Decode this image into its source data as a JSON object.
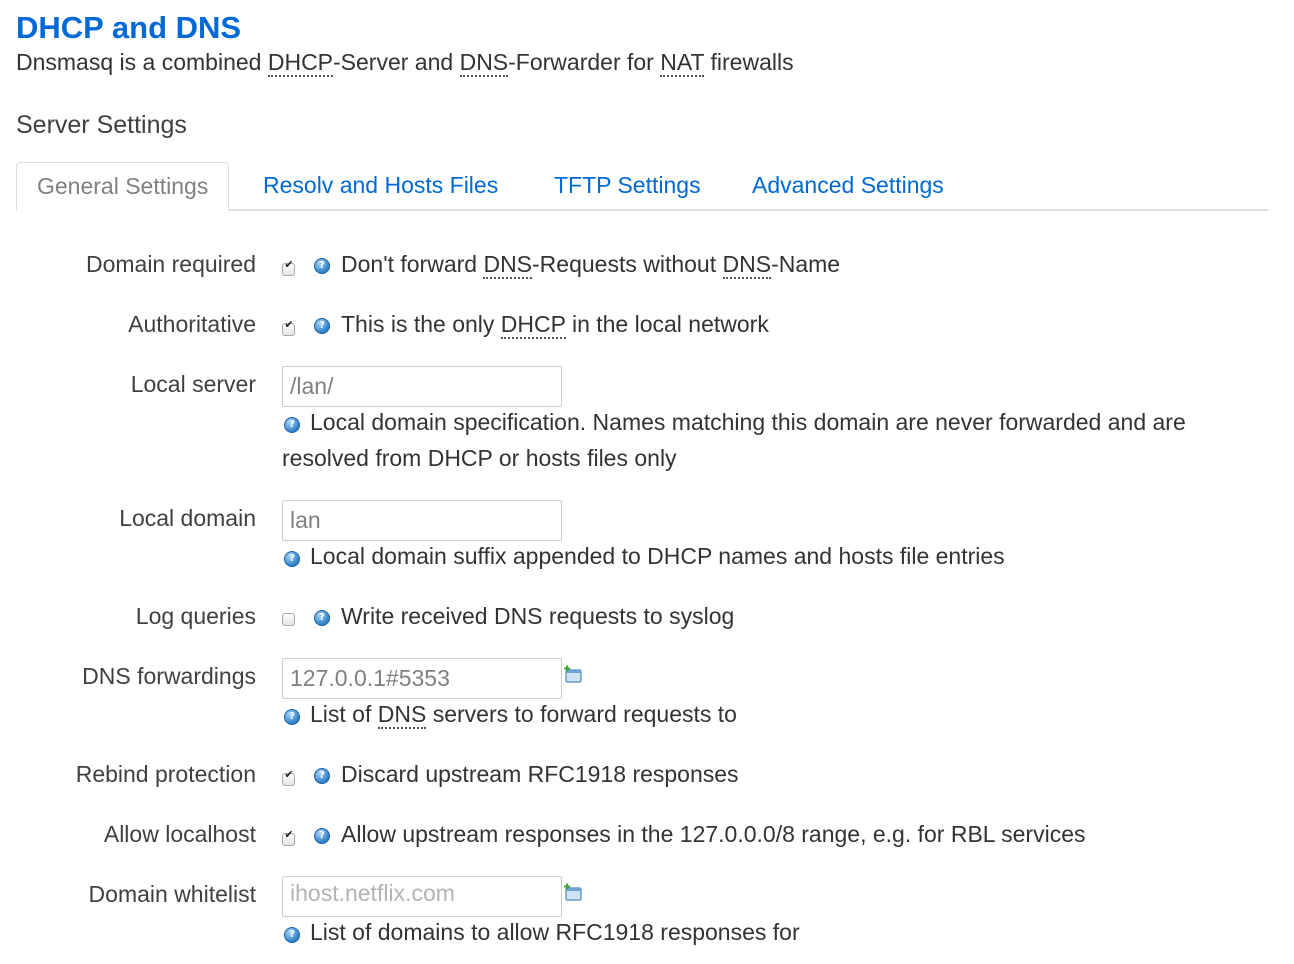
{
  "header": {
    "title": "DHCP and DNS",
    "desc_parts": [
      "Dnsmasq is a combined ",
      "DHCP",
      "-Server and ",
      "DNS",
      "-Forwarder for ",
      "NAT",
      " firewalls"
    ]
  },
  "section": {
    "title": "Server Settings"
  },
  "tabs": [
    {
      "label": "General Settings",
      "active": true
    },
    {
      "label": "Resolv and Hosts Files",
      "active": false
    },
    {
      "label": "TFTP Settings",
      "active": false
    },
    {
      "label": "Advanced Settings",
      "active": false
    }
  ],
  "fields": {
    "domain_required": {
      "label": "Domain required",
      "checked": true,
      "desc_parts": [
        "Don't forward ",
        "DNS",
        "-Requests without ",
        "DNS",
        "-Name"
      ]
    },
    "authoritative": {
      "label": "Authoritative",
      "checked": true,
      "desc_parts": [
        "This is the only ",
        "DHCP",
        " in the local network"
      ]
    },
    "local_server": {
      "label": "Local server",
      "value": "/lan/",
      "desc": "Local domain specification. Names matching this domain are never forwarded and are resolved from DHCP or hosts files only"
    },
    "local_domain": {
      "label": "Local domain",
      "value": "lan",
      "desc": "Local domain suffix appended to DHCP names and hosts file entries"
    },
    "log_queries": {
      "label": "Log queries",
      "checked": false,
      "desc": "Write received DNS requests to syslog"
    },
    "dns_forwardings": {
      "label": "DNS forwardings",
      "value": "127.0.0.1#5353",
      "desc_parts": [
        "List of ",
        "DNS",
        " servers to forward requests to"
      ]
    },
    "rebind_protection": {
      "label": "Rebind protection",
      "checked": true,
      "desc": "Discard upstream RFC1918 responses"
    },
    "allow_localhost": {
      "label": "Allow localhost",
      "checked": true,
      "desc": "Allow upstream responses in the 127.0.0.0/8 range, e.g. for RBL services"
    },
    "domain_whitelist": {
      "label": "Domain whitelist",
      "placeholder": "ihost.netflix.com",
      "desc": "List of domains to allow RFC1918 responses for"
    }
  },
  "colors": {
    "title": "#0069d6",
    "link": "#0069d6",
    "help_icon": "#2d7fc9",
    "add_icon": "#3cab2c"
  },
  "icons": {
    "help": "help-icon",
    "add": "add-entry-icon",
    "check": "checkmark-icon"
  }
}
